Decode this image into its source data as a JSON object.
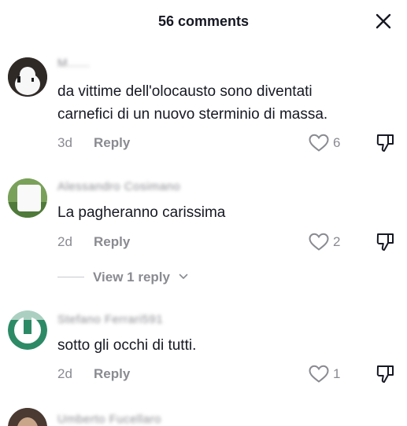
{
  "header": {
    "title": "56 comments"
  },
  "comments": [
    {
      "username": "M......",
      "text_lines": [
        "da vittime dell'olocausto sono diventati",
        "carnefici di un nuovo sterminio di massa."
      ],
      "time": "3d",
      "reply_label": "Reply",
      "likes": "6"
    },
    {
      "username": "Alessandro Cosimano",
      "text_lines": [
        "La pagheranno carissima"
      ],
      "time": "2d",
      "reply_label": "Reply",
      "likes": "2",
      "view_replies_label": "View 1 reply"
    },
    {
      "username": "Stefano Ferrari591",
      "text_lines": [
        "sotto gli occhi di tutti."
      ],
      "time": "2d",
      "reply_label": "Reply",
      "likes": "1"
    },
    {
      "username": "Umberto Fucellaro"
    }
  ],
  "colors": {
    "text": "#161823",
    "muted": "#8a8b91"
  }
}
